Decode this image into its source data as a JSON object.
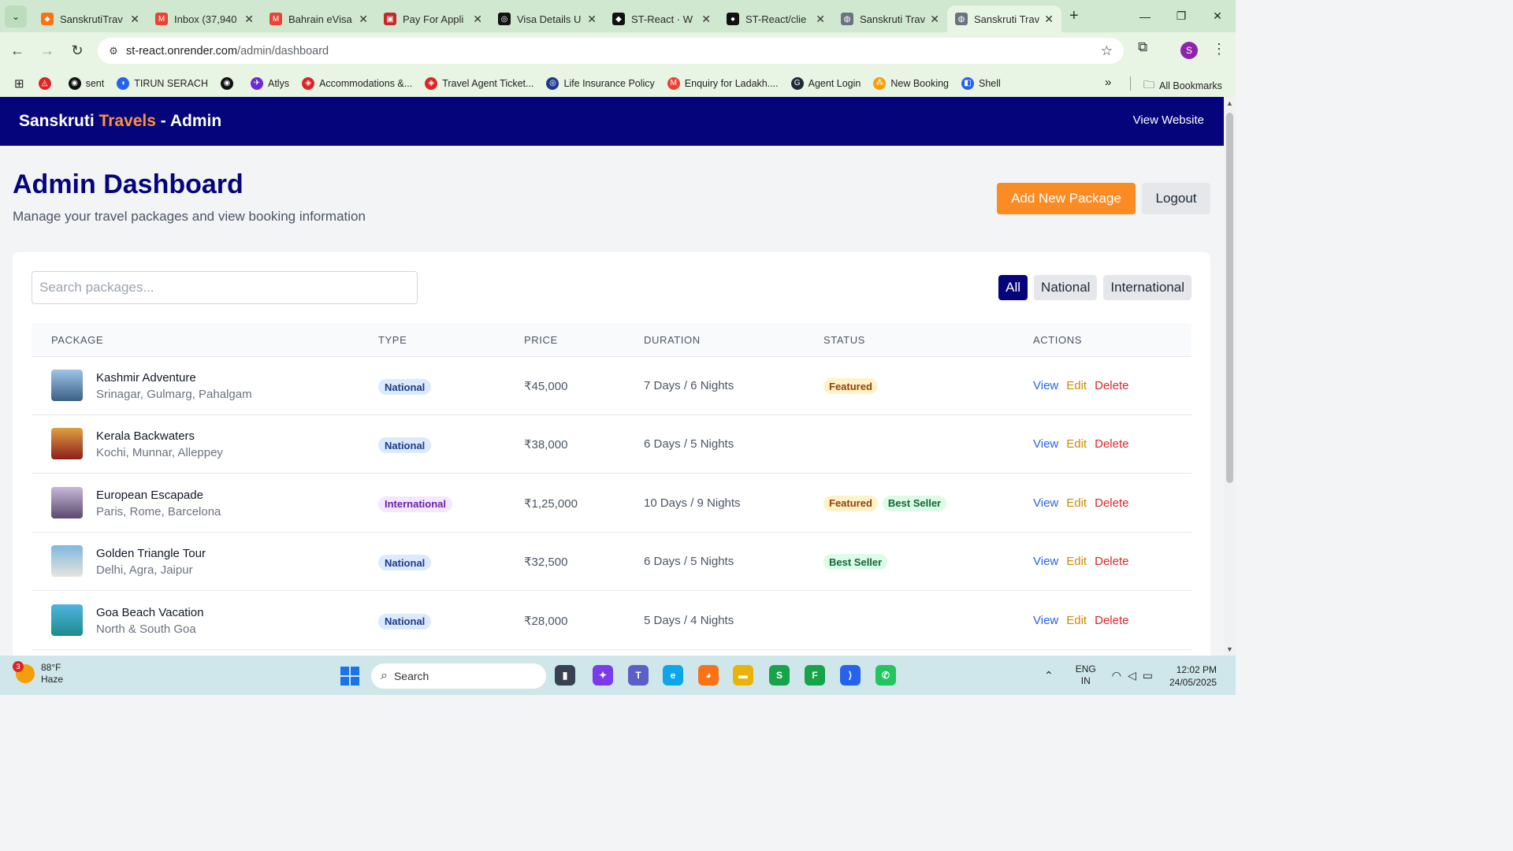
{
  "browser": {
    "tabs": [
      {
        "title": "SanskrutiTrav",
        "color": "#f97316",
        "glyph": "⬥",
        "active": false
      },
      {
        "title": "Inbox (37,940",
        "color": "#ea4335",
        "glyph": "M",
        "active": false
      },
      {
        "title": "Bahrain eVisa",
        "color": "#ea4335",
        "glyph": "M",
        "active": false
      },
      {
        "title": "Pay For Appli",
        "color": "#c62828",
        "glyph": "▣",
        "active": false
      },
      {
        "title": "Visa Details U",
        "color": "#111111",
        "glyph": "◎",
        "active": false
      },
      {
        "title": "ST-React · W",
        "color": "#111111",
        "glyph": "◆",
        "active": false
      },
      {
        "title": "ST-React/clie",
        "color": "#111111",
        "glyph": "●",
        "active": false
      },
      {
        "title": "Sanskruti Trav",
        "color": "#6b7280",
        "glyph": "◍",
        "active": false
      },
      {
        "title": "Sanskruti Trav",
        "color": "#6b7280",
        "glyph": "◍",
        "active": true
      }
    ],
    "url_host": "st-react.onrender.com",
    "url_path": "/admin/dashboard",
    "profile_initial": "S",
    "bookmarks": [
      {
        "label": "",
        "color": "#dc2626",
        "glyph": "◬"
      },
      {
        "label": "sent",
        "color": "#111111",
        "glyph": "◉"
      },
      {
        "label": "TIRUN SERACH",
        "color": "#2563eb",
        "glyph": "◖"
      },
      {
        "label": "",
        "color": "#111111",
        "glyph": "◉"
      },
      {
        "label": "Atlys",
        "color": "#6d28d9",
        "glyph": "✈"
      },
      {
        "label": "Accommodations &...",
        "color": "#dc2626",
        "glyph": "◈"
      },
      {
        "label": "Travel Agent Ticket...",
        "color": "#dc2626",
        "glyph": "◈"
      },
      {
        "label": "Life Insurance Policy",
        "color": "#1e3a8a",
        "glyph": "◎"
      },
      {
        "label": "Enquiry for Ladakh....",
        "color": "#ea4335",
        "glyph": "M"
      },
      {
        "label": "Agent Login",
        "color": "#1f2937",
        "glyph": "G"
      },
      {
        "label": "New Booking",
        "color": "#f59e0b",
        "glyph": "⁂"
      },
      {
        "label": "Shell",
        "color": "#2563eb",
        "glyph": "◧"
      }
    ],
    "all_bookmarks_label": "All Bookmarks"
  },
  "site": {
    "brand_part1": "Sanskruti",
    "brand_part2": "Travels",
    "brand_part3": "- Admin",
    "view_website": "View Website"
  },
  "page": {
    "title": "Admin Dashboard",
    "subtitle": "Manage your travel packages and view booking information",
    "add_button": "Add New Package",
    "logout_button": "Logout"
  },
  "search": {
    "placeholder": "Search packages...",
    "value": ""
  },
  "filters": [
    {
      "label": "All",
      "active": true
    },
    {
      "label": "National",
      "active": false
    },
    {
      "label": "International",
      "active": false
    }
  ],
  "table": {
    "headers": [
      "PACKAGE",
      "TYPE",
      "PRICE",
      "DURATION",
      "STATUS",
      "ACTIONS"
    ],
    "action_labels": {
      "view": "View",
      "edit": "Edit",
      "delete": "Delete"
    },
    "rows": [
      {
        "name": "Kashmir Adventure",
        "locations": "Srinagar, Gulmarg, Pahalgam",
        "type": "National",
        "price": "₹45,000",
        "duration": "7 Days / 6 Nights",
        "statuses": [
          "Featured"
        ],
        "thumb": [
          "#9ec5e8",
          "#3b5f85"
        ]
      },
      {
        "name": "Kerala Backwaters",
        "locations": "Kochi, Munnar, Alleppey",
        "type": "National",
        "price": "₹38,000",
        "duration": "6 Days / 5 Nights",
        "statuses": [],
        "thumb": [
          "#e0a040",
          "#8b1e1e"
        ]
      },
      {
        "name": "European Escapade",
        "locations": "Paris, Rome, Barcelona",
        "type": "International",
        "price": "₹1,25,000",
        "duration": "10 Days / 9 Nights",
        "statuses": [
          "Featured",
          "Best Seller"
        ],
        "thumb": [
          "#c7b7d8",
          "#5b4a6e"
        ]
      },
      {
        "name": "Golden Triangle Tour",
        "locations": "Delhi, Agra, Jaipur",
        "type": "National",
        "price": "₹32,500",
        "duration": "6 Days / 5 Nights",
        "statuses": [
          "Best Seller"
        ],
        "thumb": [
          "#7fb8e0",
          "#e8e4da"
        ]
      },
      {
        "name": "Goa Beach Vacation",
        "locations": "North & South Goa",
        "type": "National",
        "price": "₹28,000",
        "duration": "5 Days / 4 Nights",
        "statuses": [],
        "thumb": [
          "#4fb3e0",
          "#1d8c8c"
        ]
      }
    ]
  },
  "taskbar": {
    "weather_badge": "3",
    "weather_temp": "88°F",
    "weather_desc": "Haze",
    "search_label": "Search",
    "apps": [
      {
        "name": "file-explorer-dark",
        "color": "#374151",
        "glyph": "▮"
      },
      {
        "name": "copilot",
        "color": "#7c3aed",
        "glyph": "✦"
      },
      {
        "name": "teams",
        "color": "#5b5fc7",
        "glyph": "T"
      },
      {
        "name": "edge",
        "color": "#0ea5e9",
        "glyph": "e"
      },
      {
        "name": "firefox",
        "color": "#f97316",
        "glyph": "◕"
      },
      {
        "name": "file-explorer",
        "color": "#eab308",
        "glyph": "▬"
      },
      {
        "name": "chrome-s",
        "color": "#16a34a",
        "glyph": "S"
      },
      {
        "name": "chrome-f",
        "color": "#16a34a",
        "glyph": "F"
      },
      {
        "name": "vscode",
        "color": "#2563eb",
        "glyph": "⟩"
      },
      {
        "name": "whatsapp",
        "color": "#22c55e",
        "glyph": "✆"
      }
    ],
    "lang1": "ENG",
    "lang2": "IN",
    "time": "12:02 PM",
    "date": "24/05/2025"
  }
}
